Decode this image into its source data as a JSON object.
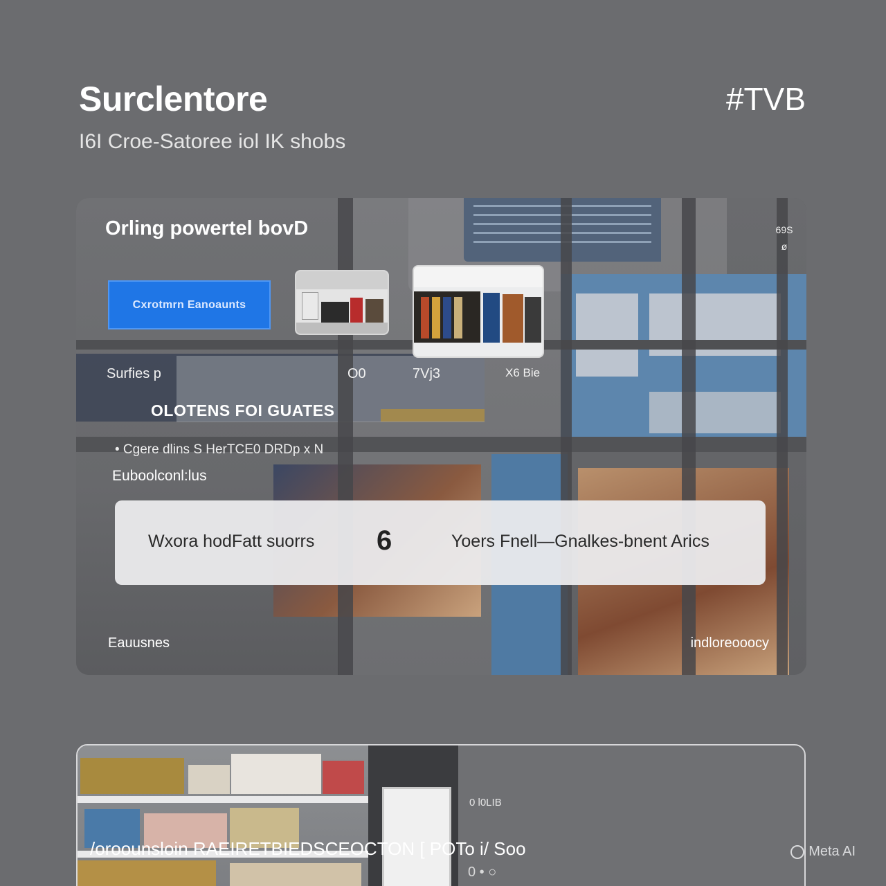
{
  "header": {
    "title": "Surclentore",
    "subtitle": "I6I Croe-Satoree iol IK shobs",
    "tag": "#TVB"
  },
  "hero": {
    "heading": "Orling powertel bovD",
    "corner_badge_top": "69S",
    "corner_badge_bottom": "ø",
    "cta_label": "Cxrotmrn Eanoaunts",
    "meta": [
      "Surfies p",
      "O0",
      "7Vj3",
      "X6 Bie"
    ],
    "section_heading": "OLOTENS FOI GUATES",
    "bullet": "• Cgere dlins S HerTCE0 DRDp x N",
    "sub_label": "Euboolconl:lus",
    "info_bar": {
      "left": "Wxora hodFatt suorrs",
      "mid": "6",
      "right": "Yoers Fnell—Gnalkes-bnent Arics"
    },
    "footer_left": "Eauusnes",
    "footer_right": "indloreooocy"
  },
  "card2": {
    "pin": "0 l0LIB",
    "label": "/oroounsloin RAEIRETBIEDSCEOCTON [ POTo i/ Soo",
    "sub": "0 • ○"
  },
  "watermark": {
    "text": "Meta AI"
  },
  "colors": {
    "background": "#6b6c6f",
    "accent_blue": "#1f76e6",
    "window_blue": "#5d86ad"
  }
}
